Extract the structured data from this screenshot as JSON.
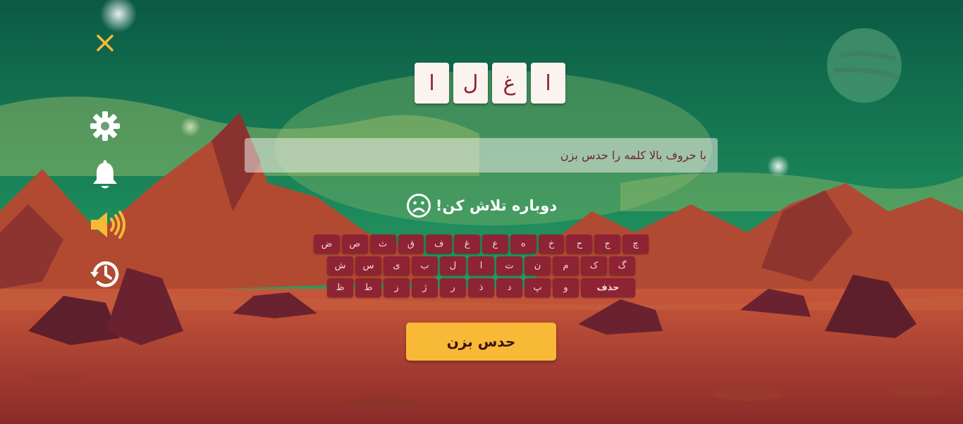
{
  "puzzle": {
    "letters": [
      "ا",
      "غ",
      "ل",
      "ا"
    ]
  },
  "answer": {
    "placeholder": "با حروف بالا کلمه را حدس بزن",
    "value": ""
  },
  "feedback": {
    "text": "دوباره تلاش کن!"
  },
  "keyboard": {
    "rows": [
      [
        "چ",
        "ج",
        "ح",
        "خ",
        "ه",
        "ع",
        "غ",
        "ف",
        "ق",
        "ث",
        "ص",
        "ض"
      ],
      [
        "گ",
        "ک",
        "م",
        "ن",
        "ت",
        "ا",
        "ل",
        "ب",
        "ی",
        "س",
        "ش"
      ],
      [
        "حذف",
        "و",
        "پ",
        "د",
        "ذ",
        "ر",
        "ژ",
        "ز",
        "ط",
        "ظ"
      ]
    ],
    "wide_keys": [
      "حذف"
    ]
  },
  "actions": {
    "guess_label": "حدس بزن"
  },
  "icons": {
    "close": "close-icon",
    "settings": "gear-icon",
    "notifications": "bell-icon",
    "sound": "speaker-icon",
    "history": "history-icon",
    "feedback": "sad-face-icon"
  },
  "colors": {
    "icon_primary": "#ffffff",
    "accent_yellow": "#f7b936",
    "tile_bg": "#fbf3f0",
    "tile_text": "#8e2334",
    "key_bg": "#8e2334",
    "key_text": "#f3d7d7",
    "sky_top": "#0b5c45",
    "ground": "#b4462e"
  }
}
